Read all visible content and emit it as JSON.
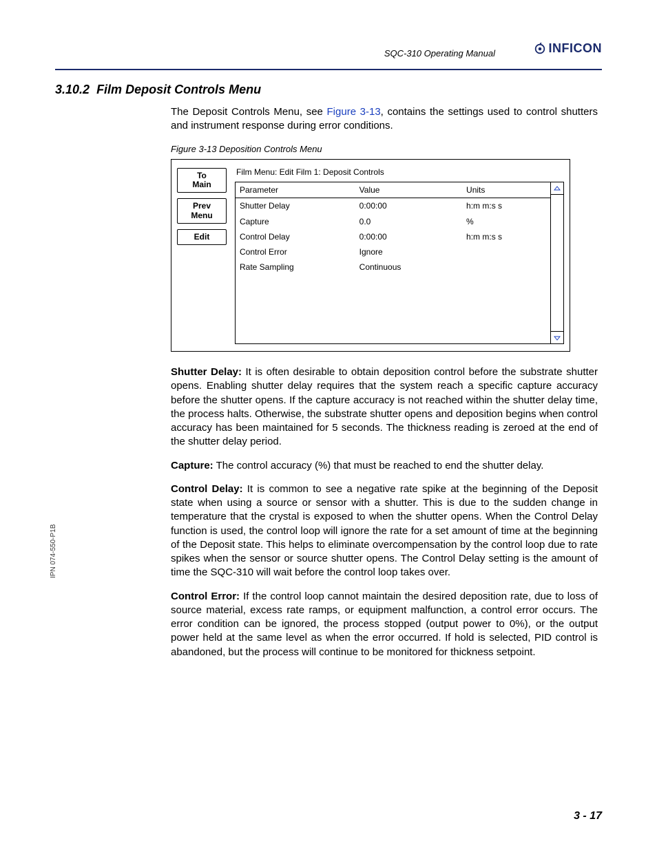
{
  "header": {
    "doc_title": "SQC-310 Operating Manual",
    "brand": "INFICON"
  },
  "section": {
    "number": "3.10.2",
    "title": "Film Deposit Controls Menu"
  },
  "intro": {
    "pre": "The Deposit Controls Menu, see ",
    "ref": "Figure 3-13",
    "post": ", contains the settings used to control shutters and instrument response during error conditions."
  },
  "figure": {
    "caption": "Figure 3-13  Deposition Controls Menu",
    "breadcrumb": "Film Menu:  Edit Film 1:  Deposit Controls",
    "soft_buttons": [
      {
        "line1": "To",
        "line2": "Main"
      },
      {
        "line1": "Prev",
        "line2": "Menu"
      },
      {
        "line1": "Edit",
        "line2": ""
      }
    ],
    "columns": {
      "param": "Parameter",
      "value": "Value",
      "units": "Units"
    },
    "rows": [
      {
        "param": "Shutter Delay",
        "value": "0:00:00",
        "units": "h:m m:s s"
      },
      {
        "param": "Capture",
        "value": "0.0",
        "units": "%"
      },
      {
        "param": "Control Delay",
        "value": "0:00:00",
        "units": "h:m m:s s"
      },
      {
        "param": "Control Error",
        "value": "Ignore",
        "units": ""
      },
      {
        "param": "Rate Sampling",
        "value": "Continuous",
        "units": ""
      }
    ]
  },
  "definitions": [
    {
      "term": "Shutter Delay:",
      "text": " It is often desirable to obtain deposition control before the substrate shutter opens. Enabling shutter delay requires that the system reach a specific capture accuracy before the shutter opens. If the capture accuracy is not reached within the shutter delay time, the process halts. Otherwise, the substrate shutter opens and deposition begins when control accuracy has been maintained for 5 seconds. The thickness reading is zeroed at the end of the shutter delay period."
    },
    {
      "term": "Capture:",
      "text": " The control accuracy (%) that must be reached to end the shutter delay."
    },
    {
      "term": "Control Delay:",
      "text": " It is common to see a negative rate spike at the beginning of the Deposit state when using a source or sensor with a shutter. This is due to the sudden change in temperature that the crystal is exposed to when the shutter opens. When the Control Delay function is used, the control loop will ignore the rate for a set amount of time at the beginning of the Deposit state. This helps to eliminate overcompensation by the control loop due to rate spikes when the sensor or source shutter opens. The Control Delay setting is the amount of time the SQC-310 will wait before the control loop takes over."
    },
    {
      "term": "Control Error:",
      "text": " If the control loop cannot maintain the desired deposition rate, due to loss of source material, excess rate ramps, or equipment malfunction, a control error occurs. The error condition can be ignored, the process stopped (output power to 0%), or the output power held at the same level as when the error occurred. If hold is selected, PID control is abandoned, but the process will continue to be monitored for thickness setpoint."
    }
  ],
  "side_label": "IPN 074-550-P1B",
  "page_number": "3 - 17"
}
